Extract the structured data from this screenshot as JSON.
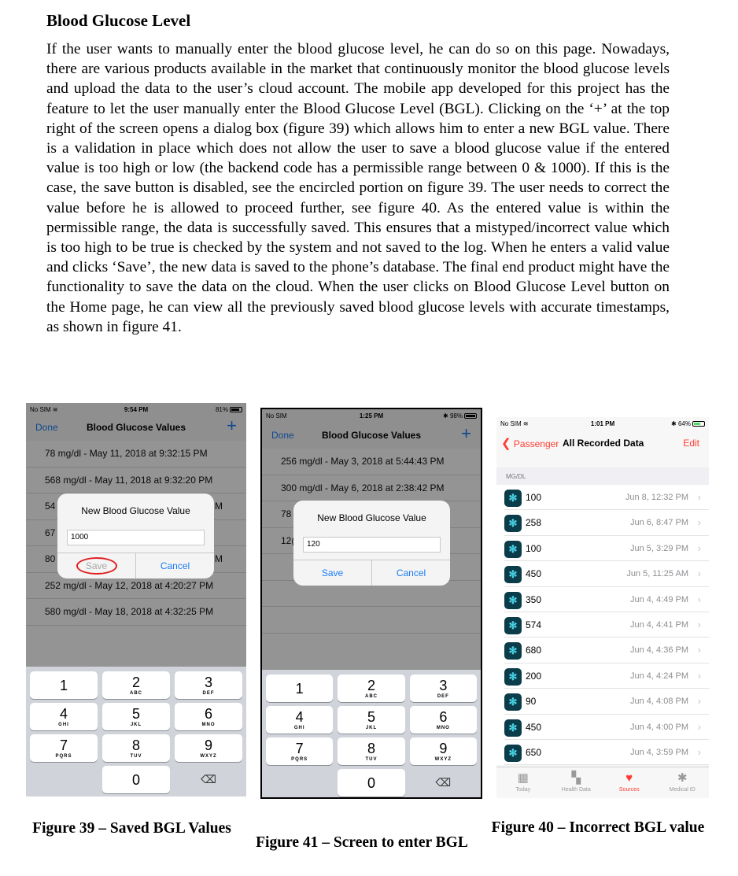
{
  "document": {
    "heading": "Blood Glucose Level",
    "paragraph": "If the user wants to manually enter the blood glucose level, he can do so on this page. Nowadays, there are various products available in the market that continuously monitor the blood glucose levels and upload the data to the user’s cloud account. The mobile app developed for this project has the feature to let the user manually enter the Blood Glucose Level (BGL). Clicking on the ‘+’ at the top right of the screen opens a dialog box (figure 39) which allows him to enter a new BGL value. There is a validation in place which does not allow the user to save a blood glucose value if the entered value is too high or low (the backend code has a permissible range between 0 & 1000). If this is the case, the save button is disabled, see the encircled portion on figure 39. The user needs to correct the value before he is allowed to proceed further, see figure 40. As the entered value is within the permissible range, the data is successfully saved. This ensures that a mistyped/incorrect value which is too high to be true is checked by the system and not saved to the log. When he enters a valid value and clicks ‘Save’, the new data is saved to the phone’s database. The final end product might have the functionality to save the data on the cloud. When the user clicks on Blood Glucose Level button on the Home page, he can view all the previously saved blood glucose levels with accurate timestamps, as shown in figure 41."
  },
  "phone1": {
    "status": {
      "carrier": "No SIM",
      "time": "9:54 PM",
      "battery": "81%",
      "battery_level": 0.81
    },
    "nav": {
      "left": "Done",
      "title": "Blood Glucose Values",
      "right": "+"
    },
    "rows": [
      "78 mg/dl - May 11, 2018 at 9:32:15 PM",
      "568 mg/dl - May 11, 2018 at 9:32:20 PM",
      "54",
      "67",
      "80",
      "252 mg/dl - May 12, 2018 at 4:20:27 PM",
      "580 mg/dl - May 18, 2018 at 4:32:25 PM"
    ],
    "row_edge_fragments": [
      "M",
      "",
      "M"
    ],
    "dialog": {
      "title": "New Blood Glucose Value",
      "input": "1000",
      "save": "Save",
      "cancel": "Cancel"
    },
    "keypad": [
      {
        "n": "1",
        "s": ""
      },
      {
        "n": "2",
        "s": "ABC"
      },
      {
        "n": "3",
        "s": "DEF"
      },
      {
        "n": "4",
        "s": "GHI"
      },
      {
        "n": "5",
        "s": "JKL"
      },
      {
        "n": "6",
        "s": "MNO"
      },
      {
        "n": "7",
        "s": "PQRS"
      },
      {
        "n": "8",
        "s": "TUV"
      },
      {
        "n": "9",
        "s": "WXYZ"
      },
      {
        "n": "0",
        "s": ""
      }
    ],
    "delete_icon": "⌫"
  },
  "phone2": {
    "status": {
      "carrier": "No SIM",
      "time": "1:25 PM",
      "battery": "98%",
      "battery_level": 0.98
    },
    "nav": {
      "left": "Done",
      "title": "Blood Glucose Values",
      "right": "+"
    },
    "rows": [
      "256 mg/dl - May 3, 2018 at 5:44:43 PM",
      "300 mg/dl - May 6, 2018 at 2:38:42 PM",
      "78",
      "12("
    ],
    "dialog": {
      "title": "New Blood Glucose Value",
      "input": "120",
      "save": "Save",
      "cancel": "Cancel"
    },
    "keypad": [
      {
        "n": "1",
        "s": ""
      },
      {
        "n": "2",
        "s": "ABC"
      },
      {
        "n": "3",
        "s": "DEF"
      },
      {
        "n": "4",
        "s": "GHI"
      },
      {
        "n": "5",
        "s": "JKL"
      },
      {
        "n": "6",
        "s": "MNO"
      },
      {
        "n": "7",
        "s": "PQRS"
      },
      {
        "n": "8",
        "s": "TUV"
      },
      {
        "n": "9",
        "s": "WXYZ"
      },
      {
        "n": "0",
        "s": ""
      }
    ],
    "delete_icon": "⌫"
  },
  "phone3": {
    "status": {
      "carrier": "No SIM",
      "time": "1:01 PM",
      "battery": "64%",
      "battery_level": 0.64
    },
    "nav": {
      "back": "Passenger",
      "title": "All Recorded Data",
      "right": "Edit"
    },
    "section": "MG/DL",
    "records": [
      {
        "value": "100",
        "date": "Jun 8, 12:32 PM"
      },
      {
        "value": "258",
        "date": "Jun 6, 8:47 PM"
      },
      {
        "value": "100",
        "date": "Jun 5, 3:29 PM"
      },
      {
        "value": "450",
        "date": "Jun 5, 11:25 AM"
      },
      {
        "value": "350",
        "date": "Jun 4, 4:49 PM"
      },
      {
        "value": "574",
        "date": "Jun 4, 4:41 PM"
      },
      {
        "value": "680",
        "date": "Jun 4, 4:36 PM"
      },
      {
        "value": "200",
        "date": "Jun 4, 4:24 PM"
      },
      {
        "value": "90",
        "date": "Jun 4, 4:08 PM"
      },
      {
        "value": "450",
        "date": "Jun 4, 4:00 PM"
      },
      {
        "value": "650",
        "date": "Jun 4, 3:59 PM"
      }
    ],
    "tabs": [
      {
        "label": "Today",
        "icon": "▦"
      },
      {
        "label": "Health Data",
        "icon": "▚"
      },
      {
        "label": "Sources",
        "icon": "♥"
      },
      {
        "label": "Medical ID",
        "icon": "✱"
      }
    ]
  },
  "captions": {
    "fig39": "Figure 39 – Saved BGL Values",
    "fig41": "Figure 41 – Screen to enter BGL",
    "fig40": "Figure 40 – Incorrect BGL value"
  }
}
